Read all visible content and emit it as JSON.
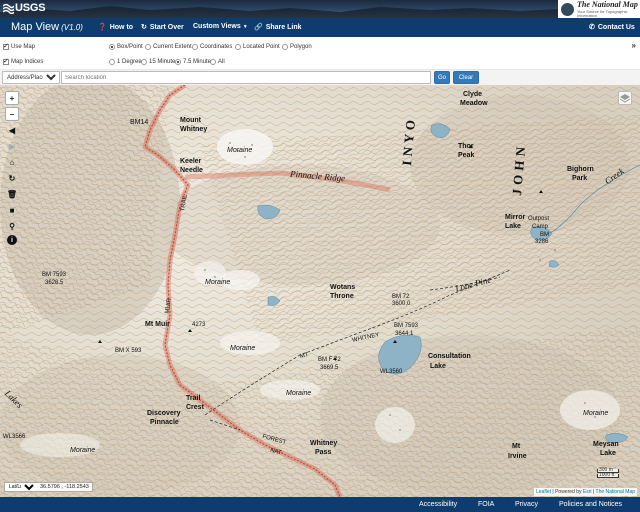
{
  "banner": {
    "agency": "USGS",
    "partner_name": "The National Map",
    "partner_tagline": "Your Source for Topographic Information"
  },
  "nav": {
    "title": "Map View",
    "version": "(V1.0)",
    "items": [
      {
        "label": "How to",
        "icon": "question-circle-icon"
      },
      {
        "label": "Start Over",
        "icon": "refresh-icon"
      },
      {
        "label": "Custom Views",
        "icon": "caret-down-icon"
      },
      {
        "label": "Share Link",
        "icon": "link-icon"
      }
    ],
    "contact": "Contact Us",
    "contact_icon": "phone-icon"
  },
  "options": {
    "use_map": {
      "label": "Use Map",
      "checked": true
    },
    "map_indices": {
      "label": "Map Indices",
      "checked": true
    },
    "extent_modes": [
      {
        "label": "Box/Point",
        "selected": true
      },
      {
        "label": "Current Extent",
        "selected": false
      },
      {
        "label": "Coordinates",
        "selected": false
      },
      {
        "label": "Located Point",
        "selected": false
      },
      {
        "label": "Polygon",
        "selected": false
      }
    ],
    "grid_modes": [
      {
        "label": "1 Degree",
        "selected": false
      },
      {
        "label": "15 Minute",
        "selected": false
      },
      {
        "label": "7.5 Minute",
        "selected": true
      },
      {
        "label": "All",
        "selected": false
      }
    ],
    "collapse_arrow": "»"
  },
  "search": {
    "type_value": "Address/Place",
    "placeholder": "Search location",
    "go_label": "Go",
    "clear_label": "Clear"
  },
  "map": {
    "controls": [
      {
        "name": "zoom-in-button",
        "glyph": "+"
      },
      {
        "name": "zoom-out-button",
        "glyph": "−"
      },
      {
        "name": "back-button",
        "glyph": "◀"
      },
      {
        "name": "forward-button",
        "glyph": "▶"
      },
      {
        "name": "home-button",
        "glyph": "⌂"
      },
      {
        "name": "refresh-button",
        "glyph": "↻"
      },
      {
        "name": "delete-button",
        "glyph": "🗑"
      },
      {
        "name": "square-button",
        "glyph": "■"
      },
      {
        "name": "pin-button",
        "glyph": "⚲"
      },
      {
        "name": "info-button",
        "glyph": "i"
      }
    ],
    "labels": {
      "mount_whitney": "Mount",
      "mount_whitney_2": "Whitney",
      "bm_14": "BM14",
      "keeler_needle": "Keeler",
      "keeler_needle_2": "Needle",
      "moraine_1": "Moraine",
      "pinnacle_ridge": "Pinnacle      Ridge",
      "inyo": "I  N  Y  O",
      "john": "J  O  H  N",
      "clyde_meadow": "Clyde",
      "clyde_meadow_2": "Meadow",
      "thor_peak": "Thor",
      "thor_peak_2": "Peak",
      "bighorn_park": "Bighorn",
      "bighorn_park_2": "Park",
      "creek": "Creek",
      "mirror_lake": "Mirror",
      "mirror_lake_2": "Lake",
      "outpost_camp": "Outpost",
      "outpost_camp_2": "Camp",
      "bm_3286": "BM",
      "bm_3286_2": "3286",
      "bm_7593": "BM 7593",
      "bm_3628": "3628.5",
      "moraine_2": "Moraine",
      "wotans_throne": "Wotans",
      "wotans_throne_2": "Throne",
      "lone_pine": "Lone   Pine",
      "bm_3600": "BM 72",
      "bm_3600_2": "3600.0",
      "mt_muir": "Mt Muir",
      "mt_muir_elev": "4273",
      "bm_7593_b": "BM 7593",
      "bm_3644": "3644.1",
      "bm_593": "BM X 593",
      "moraine_3": "Moraine",
      "whitney": "WHITNEY",
      "mt_label": "MT",
      "bm_3669": "BM F 72",
      "bm_3669_2": "3669.5",
      "consultation_lake": "Consultation",
      "consultation_lake_2": "Lake",
      "wl_3560": "WL3560",
      "trail_crest": "Trail",
      "trail_crest_2": "Crest",
      "discovery_pinnacle": "Discovery",
      "discovery_pinnacle_2": "Pinnacle",
      "moraine_4": "Moraine",
      "lakes": "Lakes",
      "wl_3566": "WL3566",
      "moraine_5": "Moraine",
      "forest": "FOREST",
      "nat": "NAT",
      "whitney_pass": "Whitney",
      "whitney_pass_2": "Pass",
      "mt_irvine": "Mt",
      "mt_irvine_2": "Irvine",
      "meysan_lake": "Meysan",
      "meysan_lake_2": "Lake",
      "moraine_6": "Moraine",
      "trail": "TRAIL",
      "muir": "MUIR"
    },
    "scale": {
      "top": "300 m",
      "bottom": "1000 ft"
    },
    "attribution": {
      "leaflet": "Leaflet",
      "sep": "| Powered by",
      "esri": "Esri",
      "sep2": "|",
      "tnm": "The National Map"
    },
    "coords": {
      "system": "Lat/Lng",
      "value": "36.5796 , -118.2543"
    }
  },
  "footer": {
    "links": [
      "Accessibility",
      "FOIA",
      "Privacy",
      "Policies and Notices"
    ]
  },
  "colors": {
    "navbar": "#0f3c6e",
    "trail": "#d9674f",
    "water": "#8eb3c6",
    "contour": "#b38c62"
  }
}
